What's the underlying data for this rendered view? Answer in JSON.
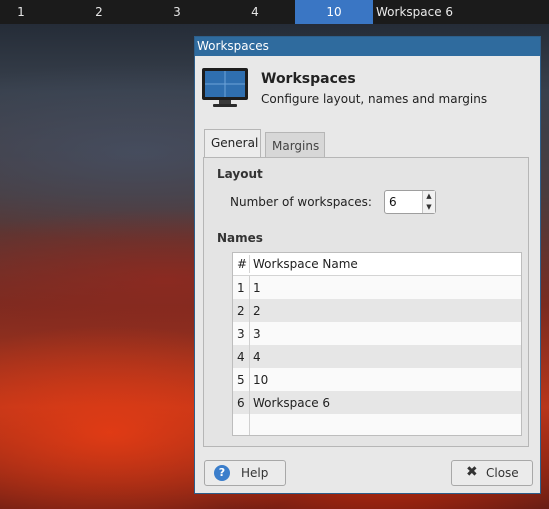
{
  "taskbar": {
    "workspaces": [
      {
        "label": "1"
      },
      {
        "label": "2"
      },
      {
        "label": "3"
      },
      {
        "label": "4"
      },
      {
        "label": "10"
      }
    ],
    "active_workspace_name": "Workspace 6",
    "active_color": "#3a76c4"
  },
  "window": {
    "title": "Workspaces",
    "header_title": "Workspaces",
    "header_subtitle": "Configure layout, names and margins",
    "icon": "monitor-icon"
  },
  "tabs": [
    {
      "label": "General",
      "active": true
    },
    {
      "label": "Margins",
      "active": false
    }
  ],
  "layout": {
    "section_title": "Layout",
    "count_label": "Number of workspaces:",
    "count_value": "6"
  },
  "names": {
    "section_title": "Names",
    "columns": [
      "#",
      "Workspace Name"
    ],
    "rows": [
      {
        "num": "1",
        "name": "1"
      },
      {
        "num": "2",
        "name": "2"
      },
      {
        "num": "3",
        "name": "3"
      },
      {
        "num": "4",
        "name": "4"
      },
      {
        "num": "5",
        "name": "10"
      },
      {
        "num": "6",
        "name": "Workspace 6"
      }
    ]
  },
  "buttons": {
    "help_label": "Help",
    "close_label": "Close"
  },
  "colors": {
    "titlebar": "#2f6b9e",
    "help_icon": "#3b7ecb"
  }
}
